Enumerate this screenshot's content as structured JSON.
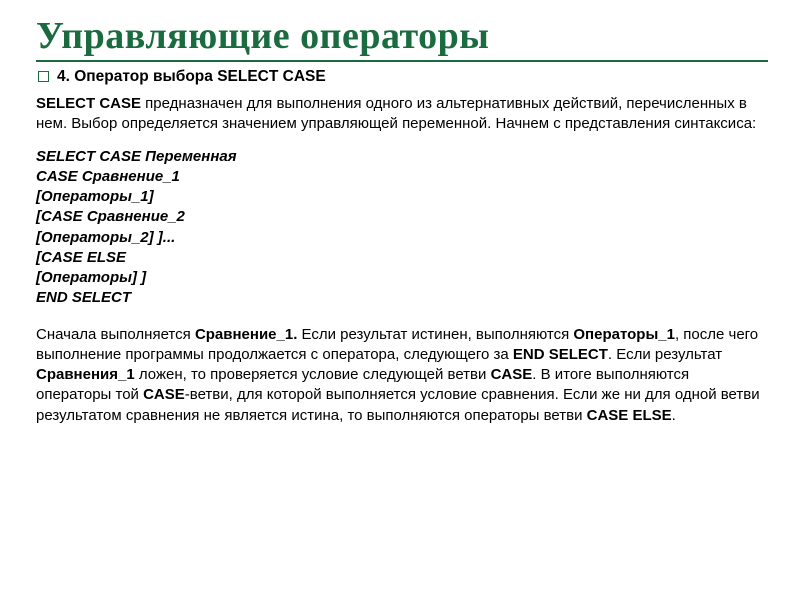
{
  "title": "Управляющие операторы",
  "subtitle": "4. Оператор выбора SELECT CASE",
  "intro": {
    "lead": "SELECT CASE",
    "rest": " предназначен для выполнения одного из альтернативных действий, перечисленных в нем. Выбор определяется значением управляющей переменной. Начнем с представления синтаксиса:"
  },
  "syntax": [
    "SELECT CASE Переменная",
    "CASE Сравнение_1",
    "[Операторы_1]",
    "[CASE Сравнение_2",
    "[Операторы_2] ]...",
    "[CASE ELSE",
    "[Операторы] ]",
    "END SELECT"
  ],
  "expl": {
    "p1a": "Сначала выполняется ",
    "p1b": "Сравнение_1.",
    "p1c": " Если результат истинен, выполняются ",
    "p1d": "Операторы_1",
    "p1e": ", после чего выполнение программы продолжается с оператора, следующего за ",
    "p1f": "END SELECT",
    "p1g": ". Если результат ",
    "p1h": "Сравнения_1",
    "p1i": " ложен, то проверяется условие следующей ветви ",
    "p1j": "CASE",
    "p1k": ". В итоге выполняются операторы той ",
    "p1l": "CASE",
    "p1m": "-ветви, для которой выполняется условие сравнения. Если же ни для одной ветви результатом сравнения не является истина, то выполняются операторы ветви ",
    "p1n": "CASE ELSE",
    "p1o": "."
  }
}
